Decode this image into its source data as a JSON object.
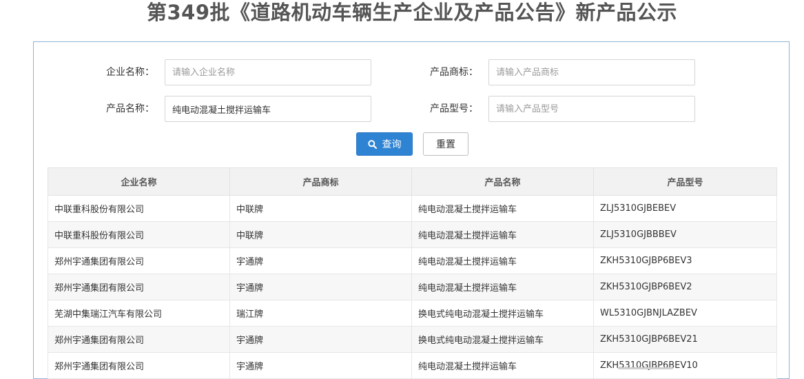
{
  "page": {
    "title": "第349批《道路机动车辆生产企业及产品公告》新产品公示"
  },
  "form": {
    "company": {
      "label": "企业名称：",
      "value": "",
      "placeholder": "请输入企业名称"
    },
    "brand": {
      "label": "产品商标：",
      "value": "",
      "placeholder": "请输入产品商标"
    },
    "product_name": {
      "label": "产品名称：",
      "value": "纯电动混凝土搅拌运输车",
      "placeholder": ""
    },
    "model": {
      "label": "产品型号：",
      "value": "",
      "placeholder": "请输入产品型号"
    },
    "query_label": "查询",
    "reset_label": "重置"
  },
  "colors": {
    "accent": "#2e83d3",
    "panel_border": "#8fb3d6",
    "header_bg": "#f2f2f2"
  },
  "icons": {
    "query": "search-icon"
  },
  "table": {
    "columns": [
      "企业名称",
      "产品商标",
      "产品名称",
      "产品型号"
    ],
    "rows": [
      [
        "中联重科股份有限公司",
        "中联牌",
        "纯电动混凝土搅拌运输车",
        "ZLJ5310GJBEBEV"
      ],
      [
        "中联重科股份有限公司",
        "中联牌",
        "纯电动混凝土搅拌运输车",
        "ZLJ5310GJBBBEV"
      ],
      [
        "郑州宇通集团有限公司",
        "宇通牌",
        "纯电动混凝土搅拌运输车",
        "ZKH5310GJBP6BEV3"
      ],
      [
        "郑州宇通集团有限公司",
        "宇通牌",
        "纯电动混凝土搅拌运输车",
        "ZKH5310GJBP6BEV2"
      ],
      [
        "芜湖中集瑞江汽车有限公司",
        "瑞江牌",
        "换电式纯电动混凝土搅拌运输车",
        "WL5310GJBNJLAZBEV"
      ],
      [
        "郑州宇通集团有限公司",
        "宇通牌",
        "换电式纯电动混凝土搅拌运输车",
        "ZKH5310GJBP6BEV21"
      ],
      [
        "郑州宇通集团有限公司",
        "宇通牌",
        "纯电动混凝土搅拌运输车",
        "ZKH5310GJBP6BEV10"
      ]
    ]
  }
}
